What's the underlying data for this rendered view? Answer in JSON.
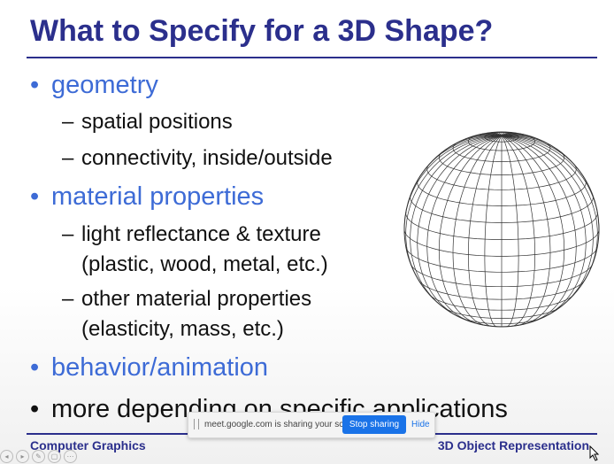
{
  "slide": {
    "title": "What to Specify for a 3D Shape?",
    "bullets": [
      {
        "marker": "•",
        "text": "geometry"
      },
      {
        "marker": "•",
        "text": "material properties"
      },
      {
        "marker": "•",
        "text": "behavior/animation"
      },
      {
        "marker": "•",
        "text": "more depending on specific applications"
      }
    ],
    "subitems": [
      {
        "marker": "–",
        "text": "spatial positions"
      },
      {
        "marker": "–",
        "text": "connectivity, inside/outside"
      },
      {
        "marker": "–",
        "text": "light reflectance & texture"
      },
      {
        "text": "(plastic, wood, metal, etc.)"
      },
      {
        "marker": "–",
        "text": "other material properties"
      },
      {
        "text": "(elasticity, mass, etc.)"
      }
    ],
    "footer_left": "Computer Graphics",
    "footer_right": "3D Object Representation"
  },
  "share_bar": {
    "message": "meet.google.com is sharing your screen.",
    "stop_label": "Stop sharing",
    "hide_label": "Hide"
  },
  "player_controls": [
    "◂",
    "▸",
    "✎",
    "▢",
    "⋯"
  ],
  "colors": {
    "title": "#2b2f8c",
    "accent_bullet": "#3d6bd6",
    "text": "#111111",
    "share_button": "#1a73e8"
  },
  "icons": {
    "sphere": "wireframe-sphere-icon",
    "cursor": "mouse-cursor-icon"
  }
}
